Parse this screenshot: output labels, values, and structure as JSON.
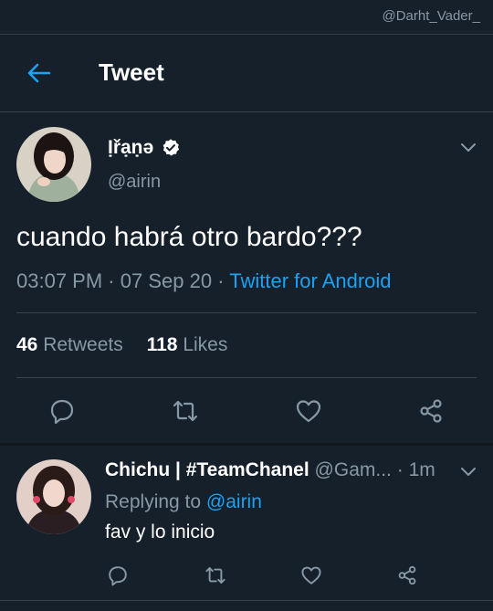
{
  "watermark": "@Darht_Vader_",
  "header": {
    "title": "Tweet"
  },
  "tweet": {
    "author_name": "Ịřạṇə",
    "author_handle": "@airin",
    "text": "cuando habrá otro bardo???",
    "time": "03:07 PM",
    "date": "07 Sep 20",
    "source": "Twitter for Android",
    "retweets_count": "46",
    "retweets_label": "Retweets",
    "likes_count": "118",
    "likes_label": "Likes"
  },
  "reply": {
    "author_name": "Chichu | #TeamChanel",
    "author_handle": "@Gam...",
    "time": "1m",
    "replying_prefix": "Replying to",
    "replying_handle": "@airin",
    "text": "fav y lo inicio"
  },
  "colors": {
    "background": "#15202b",
    "accent": "#1da1f2",
    "muted": "#8899a6",
    "divider": "#38444d"
  },
  "icons": [
    "back-arrow-icon",
    "verified-badge-icon",
    "chevron-down-icon",
    "reply-icon",
    "retweet-icon",
    "like-icon",
    "share-icon"
  ]
}
